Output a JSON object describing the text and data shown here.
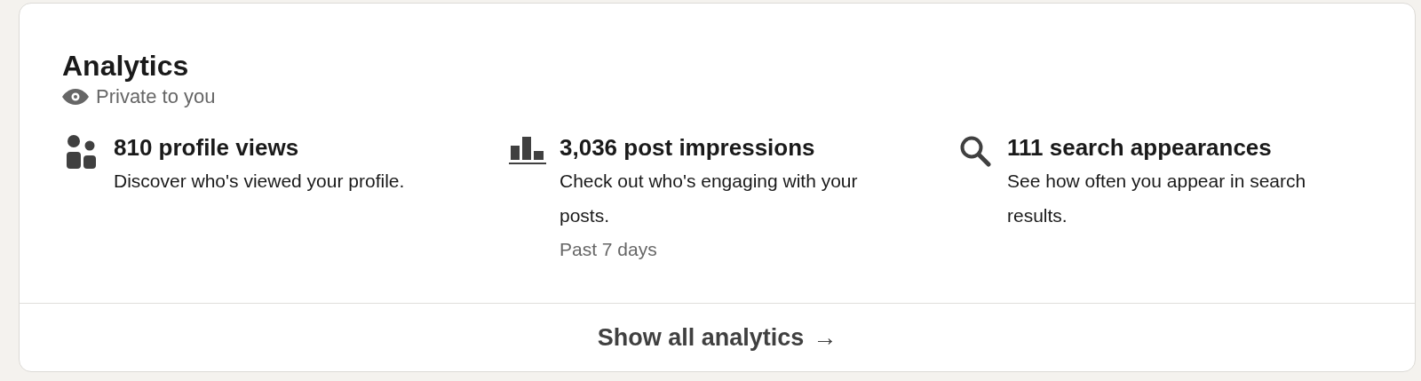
{
  "card": {
    "title": "Analytics",
    "privacy": "Private to you",
    "metrics": [
      {
        "kind": "people",
        "headline": "810 profile views",
        "description": "Discover who's viewed your profile."
      },
      {
        "kind": "chart",
        "headline": "3,036 post impressions",
        "description": "Check out who's engaging with your posts.",
        "note": "Past 7 days"
      },
      {
        "kind": "search",
        "headline": "111 search appearances",
        "description": "See how often you appear in search results."
      }
    ],
    "footer": {
      "label": "Show all analytics",
      "arrow": "→"
    }
  }
}
